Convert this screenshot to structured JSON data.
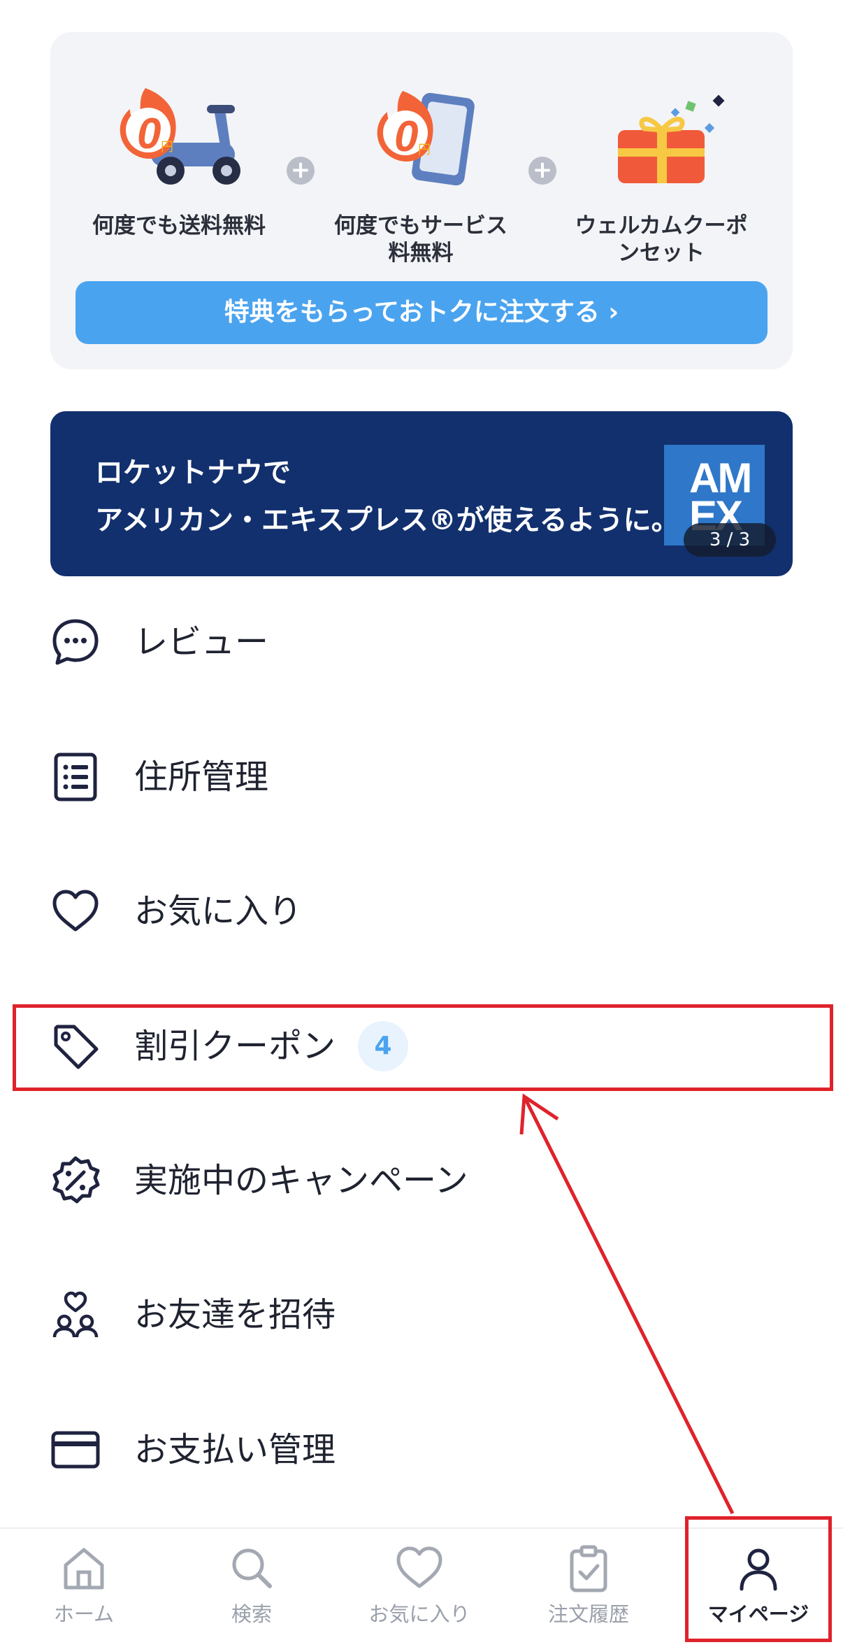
{
  "promo": {
    "benefits": [
      {
        "label": "何度でも送料無料",
        "icon": "free-shipping-scooter-icon",
        "badge_text": "0",
        "badge_unit": "円"
      },
      {
        "label": "何度でもサービス料無料",
        "icon": "free-service-phone-icon",
        "badge_text": "0",
        "badge_unit": "円"
      },
      {
        "label": "ウェルカムクーポンセット",
        "icon": "gift-box-icon"
      }
    ],
    "cta_label": "特典をもらっておトクに注文する",
    "cta_chevron": "›"
  },
  "banner": {
    "line1": "ロケットナウで",
    "line2": "アメリカン・エキスプレス®が使えるように。",
    "logo_line1": "AM",
    "logo_line2": "EX",
    "counter": "3 / 3"
  },
  "menu": [
    {
      "label": "レビュー",
      "icon": "chat-bubble-icon"
    },
    {
      "label": "住所管理",
      "icon": "list-document-icon"
    },
    {
      "label": "お気に入り",
      "icon": "heart-icon"
    },
    {
      "label": "割引クーポン",
      "icon": "tag-icon",
      "badge": "4"
    },
    {
      "label": "実施中のキャンペーン",
      "icon": "percent-badge-icon"
    },
    {
      "label": "お友達を招待",
      "icon": "invite-friends-icon"
    },
    {
      "label": "お支払い管理",
      "icon": "credit-card-icon"
    }
  ],
  "tabs": [
    {
      "label": "ホーム",
      "icon": "home-icon",
      "active": false
    },
    {
      "label": "検索",
      "icon": "search-icon",
      "active": false
    },
    {
      "label": "お気に入り",
      "icon": "heart-icon",
      "active": false
    },
    {
      "label": "注文履歴",
      "icon": "clipboard-check-icon",
      "active": false
    },
    {
      "label": "マイページ",
      "icon": "person-icon",
      "active": true
    }
  ],
  "colors": {
    "accent": "#4aa3ef",
    "banner_bg": "#12306e",
    "annotation_red": "#e0222b",
    "icon_dark": "#1f2340"
  }
}
